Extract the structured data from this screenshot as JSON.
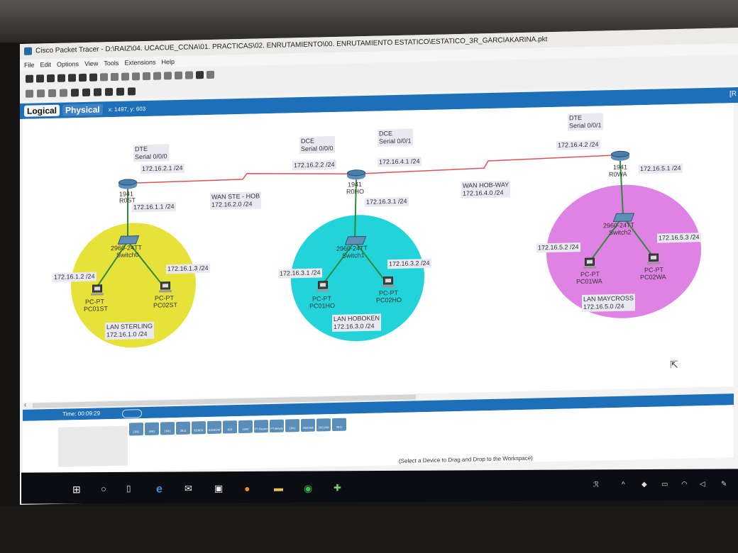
{
  "window": {
    "title": "Cisco Packet Tracer - D:\\RAIZ\\04. UCACUE_CCNA\\01. PRACTICAS\\02. ENRUTAMIENTO\\00. ENRUTAMIENTO ESTATICO\\ESTATICO_3R_GARCIAKARINA.pkt"
  },
  "menu": [
    "File",
    "Edit",
    "Options",
    "View",
    "Tools",
    "Extensions",
    "Help"
  ],
  "tabs": {
    "logical": "Logical",
    "physical": "Physical",
    "coords": "x: 1497, y: 603",
    "right_bracket": "[R"
  },
  "routers": [
    {
      "model": "1941",
      "name": "R0ST"
    },
    {
      "model": "1941",
      "name": "R0HO"
    },
    {
      "model": "1941",
      "name": "R0WA"
    }
  ],
  "switches": [
    {
      "model": "2960-24TT",
      "name": "Switch0"
    },
    {
      "model": "2960-24TT",
      "name": "Switch1"
    },
    {
      "model": "2960-24TT",
      "name": "Switch2"
    }
  ],
  "pcs": [
    {
      "model": "PC-PT",
      "name": "PC01ST"
    },
    {
      "model": "PC-PT",
      "name": "PC02ST"
    },
    {
      "model": "PC-PT",
      "name": "PC01HO"
    },
    {
      "model": "PC-PT",
      "name": "PC02HO"
    },
    {
      "model": "PC-PT",
      "name": "PC01WA"
    },
    {
      "model": "PC-PT",
      "name": "PC02WA"
    }
  ],
  "labels": {
    "dte_st": "DTE",
    "serial_st": "Serial 0/0/0",
    "ip_st_serial": "172.16.2.1 /24",
    "ip_st_gw": "172.16.1.1 /24",
    "dce_ho_left": "DCE",
    "serial_ho_left": "Serial 0/0/0",
    "ip_ho_serial_left": "172.16.2.2 /24",
    "dce_ho_right": "DCE",
    "serial_ho_right": "Serial 0/0/1",
    "ip_ho_serial_right": "172.16.4.1 /24",
    "ip_ho_gw": "172.16.3.1 /24",
    "dte_wa": "DTE",
    "serial_wa": "Serial 0/0/1",
    "ip_wa_serial": "172.16.4.2 /24",
    "ip_wa_gw": "172.16.5.1 /24",
    "wan1_name": "WAN STE - HOB",
    "wan1_net": "172.16.2.0 /24",
    "wan2_name": "WAN HOB-WAY",
    "wan2_net": "172.16.4.0 /24",
    "ip_pc01st": "172.16.1.2 /24",
    "ip_pc02st": "172.16.1.3 /24",
    "ip_pc01ho": "172.16.3.1 /24",
    "ip_pc02ho": "172.16.3.2 /24",
    "ip_pc01wa": "172.16.5.2 /24",
    "ip_pc02wa": "172.16.5.3 /24",
    "lan_st_name": "LAN STERLING",
    "lan_st_net": "172.16.1.0 /24",
    "lan_ho_name": "LAN HOBOKEN",
    "lan_ho_net": "172.16.3.0 /24",
    "lan_wa_name": "LAN MAYCROSS",
    "lan_wa_net": "172.16.5.0 /24"
  },
  "colors": {
    "lan_sterling": "#e6e23a",
    "lan_hoboken": "#22d3da",
    "lan_maycross": "#de82e3",
    "wan_link": "#e0505a",
    "lan_link": "#2f8a3a",
    "tabbar": "#1d6fb8"
  },
  "timebar": {
    "time": "Time: 00:09:29"
  },
  "device_strip": [
    "1941",
    "1841",
    "1941",
    "2811",
    "819IOX",
    "819HGW",
    "829",
    "1240",
    "PT-Router",
    "PT-Empty",
    "1841",
    "2620XM",
    "2621XM",
    "2811"
  ],
  "hint": "(Select a Device to Drag and Drop to the Workspace)",
  "taskbar_icons": [
    "windows-icon",
    "search-icon",
    "task-view-icon",
    "edge-icon",
    "mail-icon",
    "store-icon",
    "firefox-icon",
    "explorer-icon",
    "chrome-icon",
    "packet-tracer-icon"
  ]
}
